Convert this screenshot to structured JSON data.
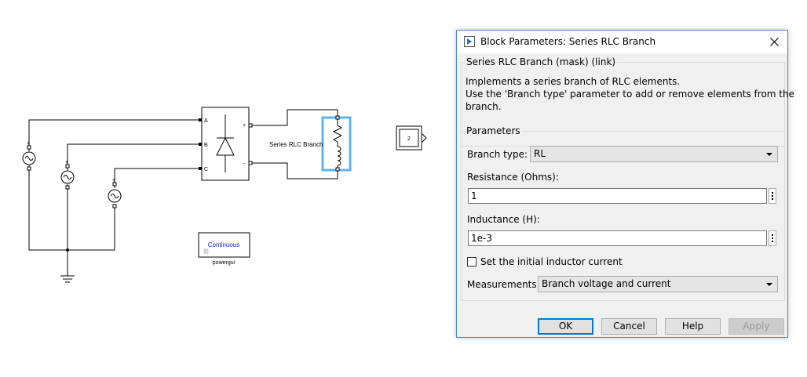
{
  "model": {
    "ports": {
      "a": "A",
      "b": "B",
      "c": "C",
      "plus": "+",
      "minus": "-"
    },
    "rlc_block_label": "Series RLC Branch",
    "scope_value": "2",
    "powergui": {
      "mode": "Continuous",
      "name": "powergui"
    }
  },
  "dialog": {
    "title": "Block Parameters: Series RLC Branch",
    "mask_group_title": "Series RLC Branch (mask) (link)",
    "description_line1": "Implements a series branch of RLC elements.",
    "description_line2": "Use the 'Branch type' parameter to add or remove elements from the",
    "description_line3": "branch.",
    "parameters_title": "Parameters",
    "branch_type_label": "Branch type:",
    "branch_type_value": "RL",
    "resistance_label": "Resistance (Ohms):",
    "resistance_value": "1",
    "inductance_label": "Inductance (H):",
    "inductance_value": "1e-3",
    "initial_current_label": "Set the initial inductor current",
    "initial_current_checked": false,
    "measurements_label": "Measurements",
    "measurements_value": "Branch voltage and current",
    "buttons": {
      "ok": "OK",
      "cancel": "Cancel",
      "help": "Help",
      "apply": "Apply"
    }
  },
  "colors": {
    "selection_highlight": "#5fb4f0",
    "dialog_border": "#4c8cc9",
    "default_button_border": "#0078d7"
  }
}
